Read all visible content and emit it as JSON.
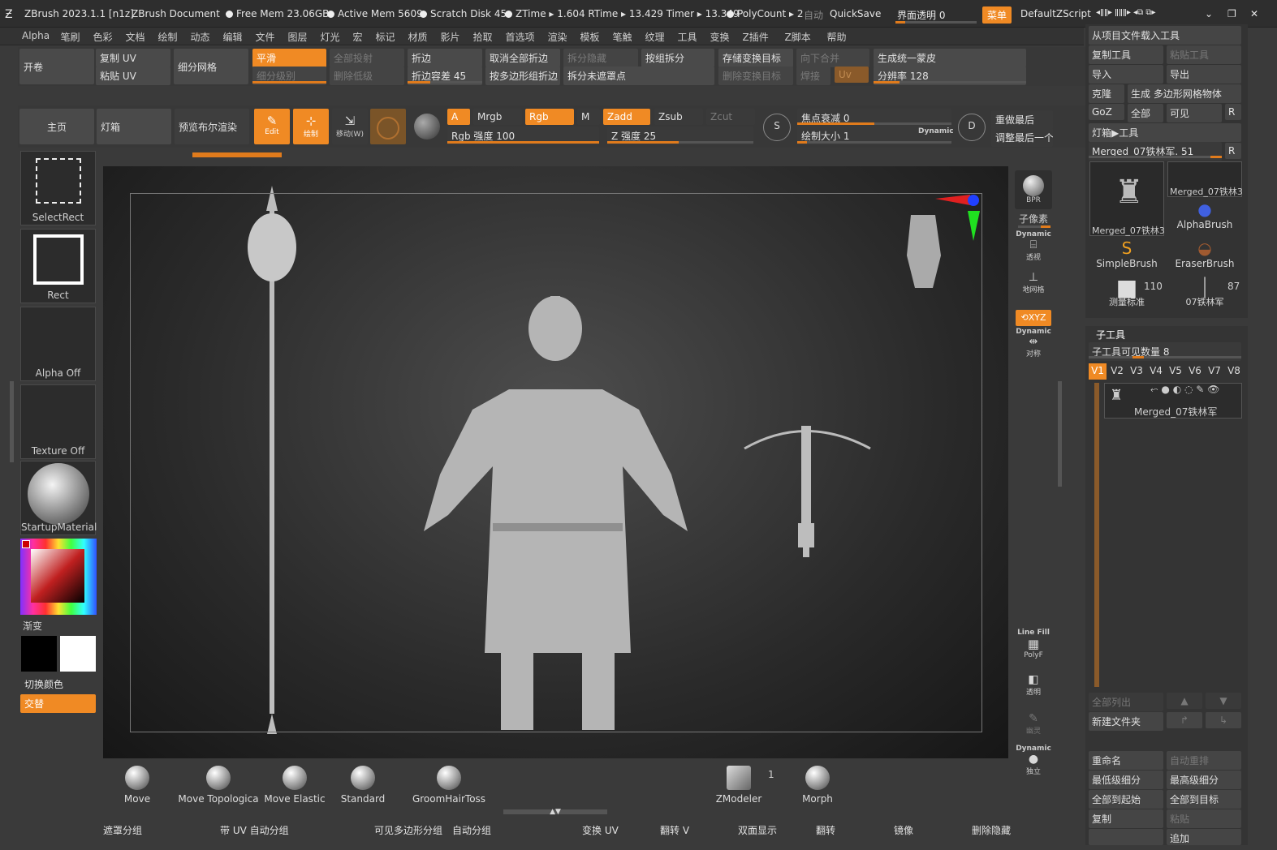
{
  "title": {
    "app": "ZBrush 2023.1.1 [n1z]",
    "doc": "ZBrush Document",
    "free_mem": "Free Mem 23.06GB",
    "active_mem": "Active Mem 5609",
    "scratch": "Scratch Disk 45",
    "ztime": "ZTime ▸ 1.604 RTime ▸ 13.429 Timer ▸ 13.349",
    "polycount": "PolyCount ▸ 2",
    "auto": "自动",
    "quicksave": "QuickSave",
    "transparency": "界面透明 0",
    "menu": "菜单",
    "script": "DefaultZScript"
  },
  "menus": [
    "Alpha",
    "笔刷",
    "色彩",
    "文档",
    "绘制",
    "动态",
    "编辑",
    "文件",
    "图层",
    "灯光",
    "宏",
    "标记",
    "材质",
    "影片",
    "拾取",
    "首选项",
    "渲染",
    "模板",
    "笔触",
    "纹理",
    "工具",
    "变换",
    "Z插件",
    "Z脚本",
    "帮助"
  ],
  "toolbar1": {
    "open": "开卷",
    "copy_uv": "复制 UV",
    "paste_uv": "粘贴 UV",
    "subdiv_mesh": "细分网格",
    "smooth": "平滑",
    "subdiv_level": "细分级别",
    "project_all": "全部投射",
    "delete_lower": "删除低级",
    "crease": "折边",
    "crease_tol": "折边容差 45",
    "uncrease_all": "取消全部折边",
    "crease_pg": "按多边形组折边",
    "split_hidden": "拆分隐藏",
    "split_unmasked": "拆分未遮罩点",
    "group_split": "按组拆分",
    "store_morph": "存储变换目标",
    "delete_morph": "删除变换目标",
    "merge_down": "向下合并",
    "weld": "焊接",
    "uv": "Uv",
    "gen_skin": "生成统一蒙皮",
    "resolution": "分辨率 128"
  },
  "toolbar2": {
    "home": "主页",
    "lightbox": "灯箱",
    "preview_render": "预览布尔渲染",
    "edit": "Edit",
    "draw": "绘制",
    "move": "移动(W)",
    "a": "A",
    "mrgb": "Mrgb",
    "rgb": "Rgb",
    "m": "M",
    "zadd": "Zadd",
    "zsub": "Zsub",
    "zcut": "Zcut",
    "rgb_intensity": "Rgb 强度 100",
    "z_intensity": "Z 强度 25",
    "focal": "焦点衰减 0",
    "draw_size": "绘制大小 1",
    "dynamic": "Dynamic",
    "replay_last": "重做最后",
    "adjust_last": "调整最后一个"
  },
  "left_shelf": {
    "selectrect": "SelectRect",
    "rect": "Rect",
    "alpha_off": "Alpha Off",
    "texture_off": "Texture Off",
    "material": "StartupMaterial",
    "gradient": "渐变",
    "switch_color": "切换颜色",
    "alternate": "交替"
  },
  "right_shelf": {
    "bpr": "BPR",
    "subpixel": "子像素",
    "dynamic": "Dynamic",
    "persp": "透视",
    "floor": "地网格",
    "xyz": "XYZ",
    "sym": "对称",
    "linefill": "Line Fill",
    "polyf": "PolyF",
    "transp": "透明",
    "ghost": "幽灵",
    "solo": "独立"
  },
  "brushes": [
    "Move",
    "Move Topologica",
    "Move Elastic",
    "Standard",
    "GroomHairToss",
    "ZModeler",
    "Morph"
  ],
  "zmodeler_count": "1",
  "bottom": [
    "遮罩分组",
    "带 UV 自动分组",
    "可见多边形分组",
    "自动分组",
    "变换 UV",
    "翻转 V",
    "双面显示",
    "翻转",
    "镜像",
    "删除隐藏"
  ],
  "tool_panel": {
    "load": "从项目文件载入工具",
    "copy_tool": "复制工具",
    "paste_tool": "粘贴工具",
    "import": "导入",
    "export": "导出",
    "clone": "克隆",
    "make_poly": "生成 多边形网格物体",
    "goz": "GoZ",
    "all": "全部",
    "visible": "可见",
    "r": "R",
    "lightbox_tools": "灯箱▶工具",
    "current_tool": "Merged_07铁林军. 51",
    "thumb1": "Merged_07铁林3",
    "thumb2": "Merged_07铁林3",
    "alphabrush": "AlphaBrush",
    "simplebrush": "SimpleBrush",
    "eraserbrush": "EraserBrush",
    "measure": "测量标准",
    "measure_n": "110",
    "tool07": "07铁林军",
    "tool07_n": "87"
  },
  "subtool": {
    "header": "子工具",
    "visible_count": "子工具可见数量 8",
    "tabs": [
      "V1",
      "V2",
      "V3",
      "V4",
      "V5",
      "V6",
      "V7",
      "V8"
    ],
    "item": "Merged_07铁林军",
    "list_all": "全部列出",
    "new_folder": "新建文件夹",
    "rename": "重命名",
    "auto_reorder": "自动重排",
    "lowest": "最低级细分",
    "highest": "最高级细分",
    "all_start": "全部到起始",
    "all_target": "全部到目标",
    "duplicate": "复制",
    "paste": "粘贴",
    "append": "追加"
  }
}
